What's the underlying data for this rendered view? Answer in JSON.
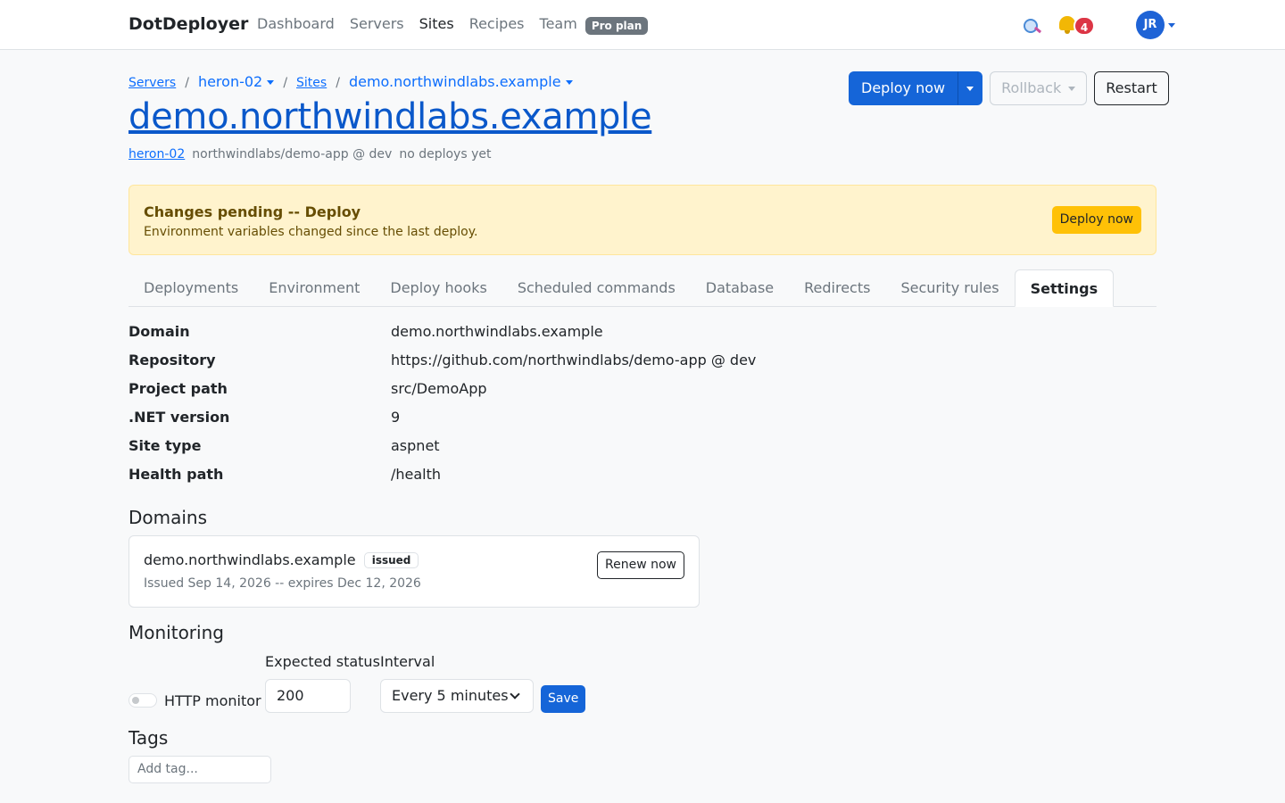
{
  "navbar": {
    "brand": "DotDeployer",
    "links": [
      "Dashboard",
      "Servers",
      "Sites",
      "Recipes",
      "Team"
    ],
    "active_link": "Sites",
    "plan_badge": "Pro plan",
    "notification_count": "4",
    "avatar_initials": "JR"
  },
  "breadcrumb": {
    "servers": "Servers",
    "server": "heron-02",
    "sites": "Sites",
    "site": "demo.northwindlabs.example"
  },
  "page": {
    "title": "demo.northwindlabs.example",
    "server_link": "heron-02",
    "repo_ref": "northwindlabs/demo-app @ dev",
    "deploy_status": "no deploys yet"
  },
  "actions": {
    "deploy": "Deploy now",
    "rollback": "Rollback",
    "restart": "Restart"
  },
  "alert": {
    "title": "Changes pending -- Deploy",
    "text": "Environment variables changed since the last deploy.",
    "button": "Deploy now"
  },
  "tabs": [
    "Deployments",
    "Environment",
    "Deploy hooks",
    "Scheduled commands",
    "Database",
    "Redirects",
    "Security rules",
    "Settings"
  ],
  "active_tab": "Settings",
  "details": [
    {
      "key": "Domain",
      "value": "demo.northwindlabs.example"
    },
    {
      "key": "Repository",
      "value": "https://github.com/northwindlabs/demo-app @ dev"
    },
    {
      "key": "Project path",
      "value": "src/DemoApp"
    },
    {
      "key": ".NET version",
      "value": "9"
    },
    {
      "key": "Site type",
      "value": "aspnet"
    },
    {
      "key": "Health path",
      "value": "/health"
    }
  ],
  "domains": {
    "heading": "Domains",
    "items": [
      {
        "name": "demo.northwindlabs.example",
        "badge": "issued",
        "dates": "Issued Sep 14, 2026 -- expires Dec 12, 2026",
        "action": "Renew now"
      }
    ]
  },
  "monitoring": {
    "heading": "Monitoring",
    "toggle_label": "HTTP monitor",
    "toggle_on": false,
    "expected_status_label": "Expected status",
    "expected_status_value": "200",
    "interval_label": "Interval",
    "interval_value": "Every 5 minutes",
    "save": "Save"
  },
  "tags": {
    "heading": "Tags",
    "placeholder": "Add tag..."
  },
  "colors": {
    "primary": "#1565d8",
    "warning_bg": "#fff3cd",
    "warning_btn": "#ffc107",
    "danger": "#dc3545"
  }
}
